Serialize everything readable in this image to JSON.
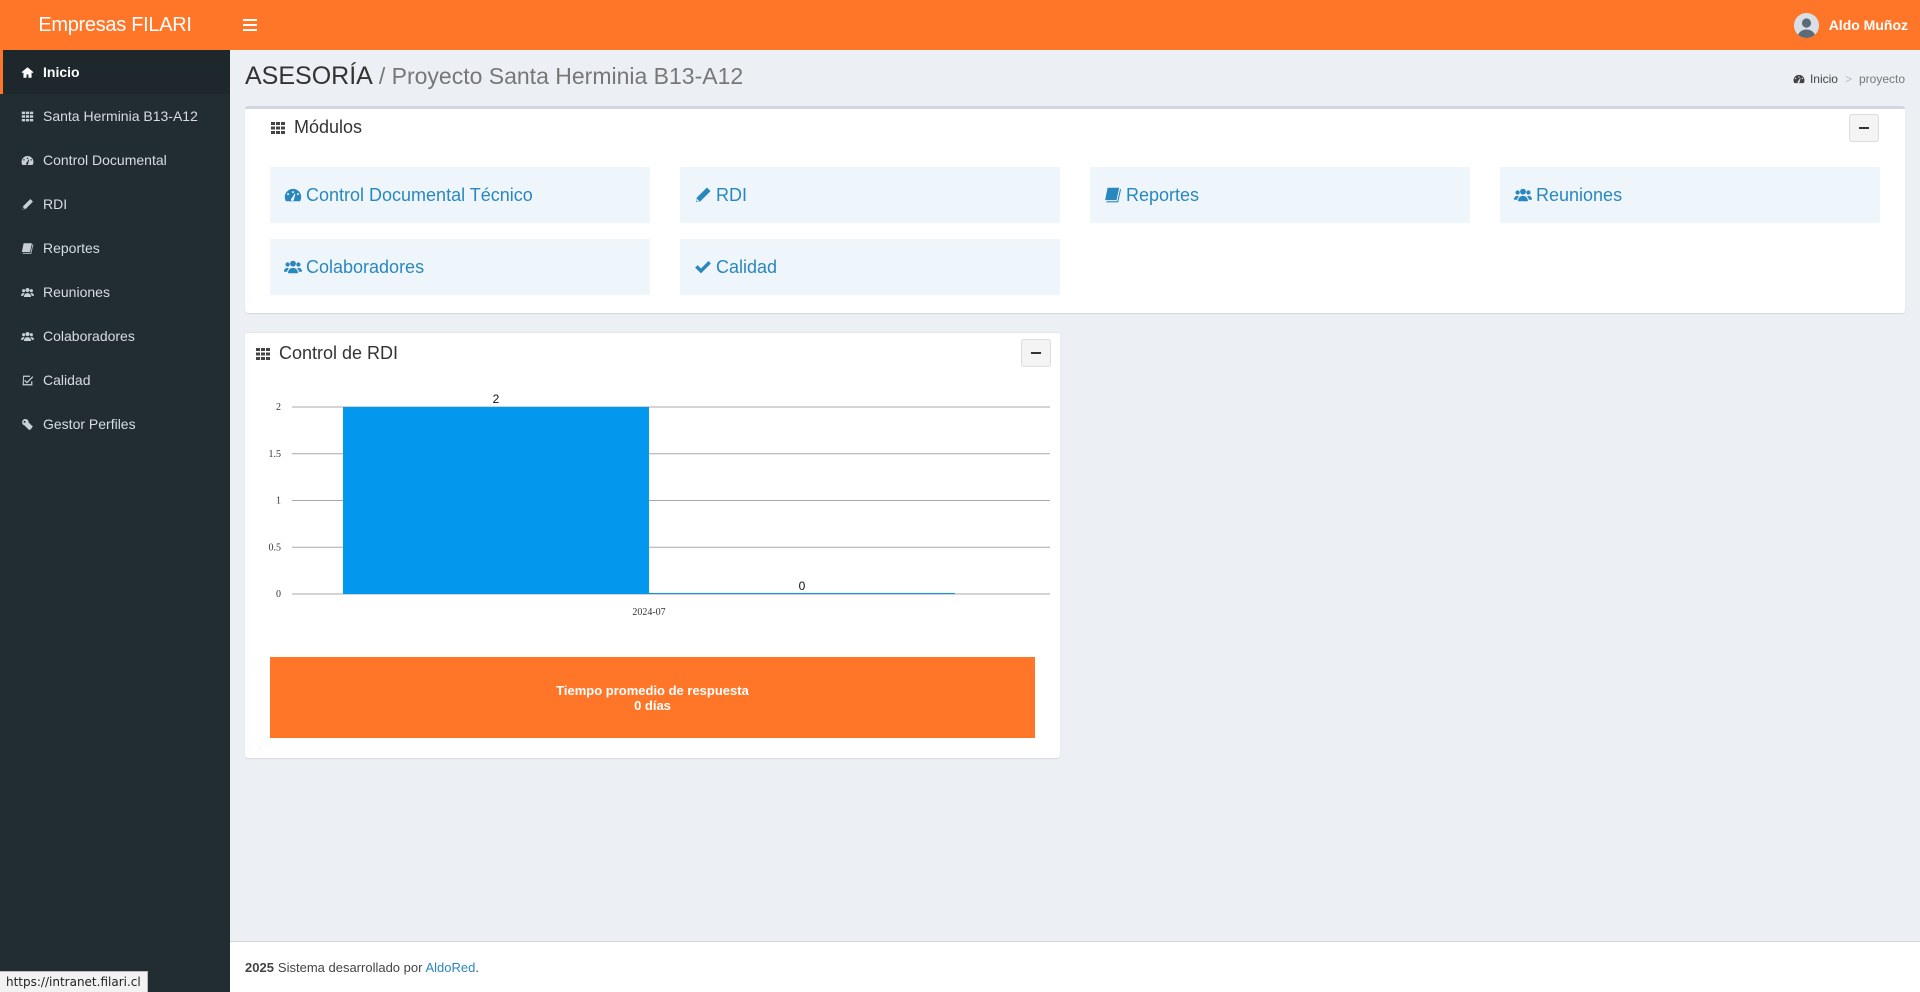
{
  "header": {
    "brand": "Empresas FILARI",
    "user_name": "Aldo Muñoz"
  },
  "sidebar": {
    "items": [
      {
        "label": "Inicio",
        "icon": "home-icon",
        "active": true
      },
      {
        "label": "Santa Herminia B13-A12",
        "icon": "grid-icon"
      },
      {
        "label": "Control Documental",
        "icon": "dashboard-icon"
      },
      {
        "label": "RDI",
        "icon": "pencil-icon"
      },
      {
        "label": "Reportes",
        "icon": "book-icon"
      },
      {
        "label": "Reuniones",
        "icon": "users-icon"
      },
      {
        "label": "Colaboradores",
        "icon": "users-icon"
      },
      {
        "label": "Calidad",
        "icon": "check-square-icon"
      },
      {
        "label": "Gestor Perfiles",
        "icon": "key-icon"
      }
    ]
  },
  "page": {
    "title": "ASESORÍA",
    "subtitle": "/ Proyecto Santa Herminia B13-A12",
    "breadcrumb": {
      "home": "Inicio",
      "current": "proyecto"
    }
  },
  "modules_box": {
    "title": "Módulos",
    "modules": [
      {
        "label": "Control Documental Técnico",
        "icon": "dashboard-icon"
      },
      {
        "label": "RDI",
        "icon": "pencil-icon"
      },
      {
        "label": "Reportes",
        "icon": "book-icon"
      },
      {
        "label": "Reuniones",
        "icon": "users-icon"
      },
      {
        "label": "Colaboradores",
        "icon": "users-icon"
      },
      {
        "label": "Calidad",
        "icon": "check-icon"
      }
    ]
  },
  "rdi_box": {
    "title": "Control de RDI",
    "stat_line1": "Tiempo promedio de respuesta",
    "stat_line2": "0 días"
  },
  "chart_data": {
    "type": "bar",
    "categories": [
      "2024-07"
    ],
    "series": [
      {
        "values": [
          2
        ],
        "color": "#0398ee"
      },
      {
        "values": [
          0
        ],
        "color": "#0398ee"
      }
    ],
    "data_labels": [
      "2",
      "0"
    ],
    "yticks": [
      "0",
      "0.5",
      "1",
      "1.5",
      "2"
    ],
    "ylim": [
      0,
      2
    ],
    "grid": true,
    "legend": "none"
  },
  "footer": {
    "year": "2025",
    "text": "Sistema desarrollado por",
    "link": "AldoRed",
    "end": "."
  },
  "status_bar": {
    "url": "https://intranet.filari.cl"
  },
  "colors": {
    "accent": "#ff7629",
    "sidebar": "#222d32",
    "link": "#2a87bd"
  }
}
